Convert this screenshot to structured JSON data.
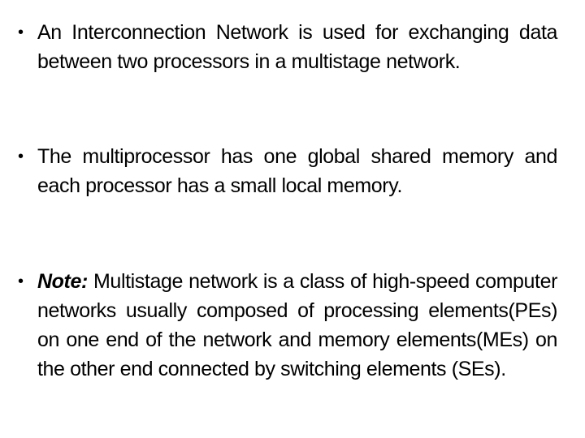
{
  "bullets": [
    {
      "text": "An Interconnection Network is used for exchanging data between two processors in a multistage network."
    },
    {
      "text": "The multiprocessor has one global shared memory and each processor has a small local memory."
    },
    {
      "prefix": "Note:",
      "text": " Multistage network is a class of high-speed computer networks usually composed of processing elements(PEs) on one end of the network and memory elements(MEs) on the other end connected by switching elements (SEs)."
    }
  ],
  "bullet_glyph": "•"
}
